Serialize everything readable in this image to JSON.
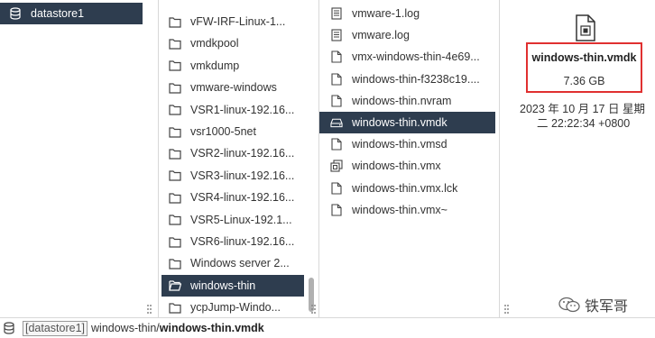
{
  "datastore_label": "datastore1",
  "folders": [
    "vFW-IRF-Linux-1...",
    "vmdkpool",
    "vmkdump",
    "vmware-windows",
    "VSR1-linux-192.16...",
    "vsr1000-5net",
    "VSR2-linux-192.16...",
    "VSR3-linux-192.16...",
    "VSR4-linux-192.16...",
    "VSR5-Linux-192.1...",
    "VSR6-linux-192.16...",
    "Windows server 2...",
    "windows-thin",
    "ycpJump-Windo..."
  ],
  "selected_folder_index": 12,
  "files": [
    {
      "name": "vmware-1.log",
      "icon": "log-file-icon"
    },
    {
      "name": "vmware.log",
      "icon": "log-file-icon"
    },
    {
      "name": "vmx-windows-thin-4e69...",
      "icon": "file-icon"
    },
    {
      "name": "windows-thin-f3238c19....",
      "icon": "file-icon"
    },
    {
      "name": "windows-thin.nvram",
      "icon": "file-icon"
    },
    {
      "name": "windows-thin.vmdk",
      "icon": "disk-icon"
    },
    {
      "name": "windows-thin.vmsd",
      "icon": "file-icon"
    },
    {
      "name": "windows-thin.vmx",
      "icon": "vm-file-icon"
    },
    {
      "name": "windows-thin.vmx.lck",
      "icon": "file-icon"
    },
    {
      "name": "windows-thin.vmx~",
      "icon": "file-icon"
    }
  ],
  "selected_file_index": 5,
  "detail": {
    "name": "windows-thin.vmdk",
    "size": "7.36 GB",
    "date_line1": "2023 年 10 月 17 日 星期",
    "date_line2": "二 22:22:34 +0800"
  },
  "status": {
    "datastore_tag": "[datastore1]",
    "path_prefix": "windows-thin/",
    "path_file": "windows-thin.vmdk"
  },
  "watermark": "铁军哥",
  "colors": {
    "selection": "#2e3d4f",
    "highlight_border": "#e03030"
  }
}
